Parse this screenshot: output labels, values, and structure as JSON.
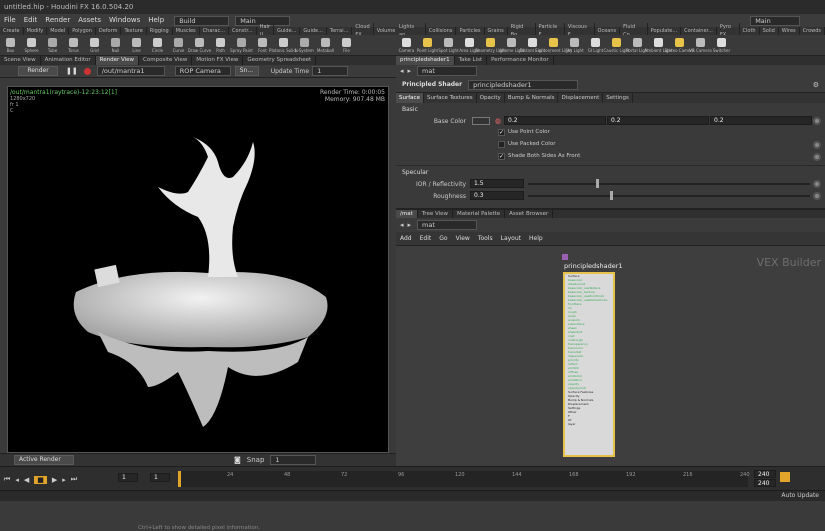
{
  "title": "untitled.hip - Houdini FX 16.0.504.20",
  "menu": [
    "File",
    "Edit",
    "Render",
    "Assets",
    "Windows",
    "Help"
  ],
  "desktop_left": "Build",
  "desktop_right": "Main",
  "right_desktop": "Main",
  "shelf_tabs_left": [
    "Create",
    "Modify",
    "Model",
    "Polygon",
    "Deform",
    "Texture",
    "Rigging",
    "Muscles",
    "Charac...",
    "Constr...",
    "Hair U...",
    "Guide...",
    "Guide...",
    "Terrai...",
    "Cloud FX",
    "Volume"
  ],
  "shelf_tabs_right": [
    "Lights an...",
    "Collisions",
    "Particles",
    "Grains",
    "Rigid Bo...",
    "Particle F...",
    "Viscous F...",
    "Oceans",
    "Fluid Co...",
    "Populate...",
    "Container...",
    "Pyro FX",
    "Cloth",
    "Solid",
    "Wires",
    "Crowds",
    "Drive Si..."
  ],
  "shelf_tools_left": [
    "Box",
    "Sphere",
    "Tube",
    "Torus",
    "Grid",
    "Null",
    "Line",
    "Circle",
    "Curve",
    "Draw Curve",
    "Path",
    "Spray Paint",
    "Font",
    "Platonic Solids",
    "L-System",
    "Metaball",
    "File"
  ],
  "shelf_tools_right": [
    "Camera",
    "Point Light",
    "Spot Light",
    "Area Light",
    "Geometry Light",
    "Volume Light",
    "Distant Light",
    "Environment Light",
    "Sky Light",
    "GI Light",
    "Caustic Light",
    "Portal Light",
    "Ambient Light",
    "Stereo Camera",
    "VR Camera",
    "Switcher"
  ],
  "viewport_tabs": [
    "Scene View",
    "Animation Editor",
    "Render View",
    "Composite View",
    "Motion FX View",
    "Geometry Spreadsheet"
  ],
  "render_toolbar": {
    "render_btn": "Render",
    "out_path": "/out/mantra1",
    "camera": "ROP Camera",
    "update_label": "Update Time",
    "update_value": "1",
    "snap_btn": "Sn..."
  },
  "render_info": {
    "path": "/out/mantra1(raytrace)-12:23:12[1]",
    "resolution": "1280x720",
    "frame": "fr 1",
    "channel": "C",
    "render_time": "Render Time: 0:00:05",
    "memory": "Memory:   907.48 MB"
  },
  "viewport_hint": "Ctrl+Left to show detailed pixel information.",
  "render_status": {
    "active_render": "Active Render",
    "snap": "Snap",
    "snap_num": "1"
  },
  "timeline": {
    "ticks": [
      "24",
      "48",
      "72",
      "96",
      "120",
      "144",
      "168",
      "192",
      "216",
      "240"
    ],
    "frame": "1",
    "start": "1",
    "end_a": "240",
    "end_b": "240"
  },
  "status": {
    "auto_update": "Auto Update"
  },
  "param_tabs": [
    "principledshader1",
    "Take List",
    "Performance Monitor"
  ],
  "param_path": "mat",
  "param_header": {
    "type": "Principled Shader",
    "name": "principledshader1"
  },
  "param_subtabs": [
    "Surface",
    "Surface Textures",
    "Opacity",
    "Bump & Normals",
    "Displacement",
    "Settings"
  ],
  "params": {
    "basic": "Basic",
    "base_color_label": "Base Color",
    "base_color": [
      "0.2",
      "0.2",
      "0.2"
    ],
    "use_point_color": "Use Point Color",
    "use_packed_color": "Use Packed Color",
    "shade_both_sides": "Shade Both Sides As Front",
    "specular": "Specular",
    "ior_label": "IOR / Reflectivity",
    "ior": "1.5",
    "roughness_label": "Roughness",
    "roughness": "0.3"
  },
  "net_tabs": [
    "/mat",
    "Tree View",
    "Material Palette",
    "Asset Browser"
  ],
  "net_path": "mat",
  "net_menu": [
    "Add",
    "Edit",
    "Go",
    "View",
    "Tools",
    "Layout",
    "Help"
  ],
  "network": {
    "context_label": "VEX Builder",
    "node_name": "principledshader1",
    "node_ports": [
      "Surface",
      "basecolor",
      "albedomult",
      "basecolor_useTexture",
      "basecolor_texture",
      "basecolor_usePointColor",
      "basecolor_usePackedColor",
      "frontface",
      "ior",
      "rough",
      "aniso",
      "anisodir",
      "subsurface",
      "sheen",
      "sheentint",
      "coat",
      "coatrough",
      "transparency",
      "transcolor",
      "transdist",
      "dispersion",
      "priority",
      "reflect",
      "emitint",
      "diffuse",
      "emitcolor",
      "emitillum",
      "opacity",
      "opacitymult",
      "Surface Features",
      "Opacity",
      "Bump & Normals",
      "Displacement",
      "Settings",
      "Other",
      "F",
      "Of",
      "layer"
    ]
  }
}
